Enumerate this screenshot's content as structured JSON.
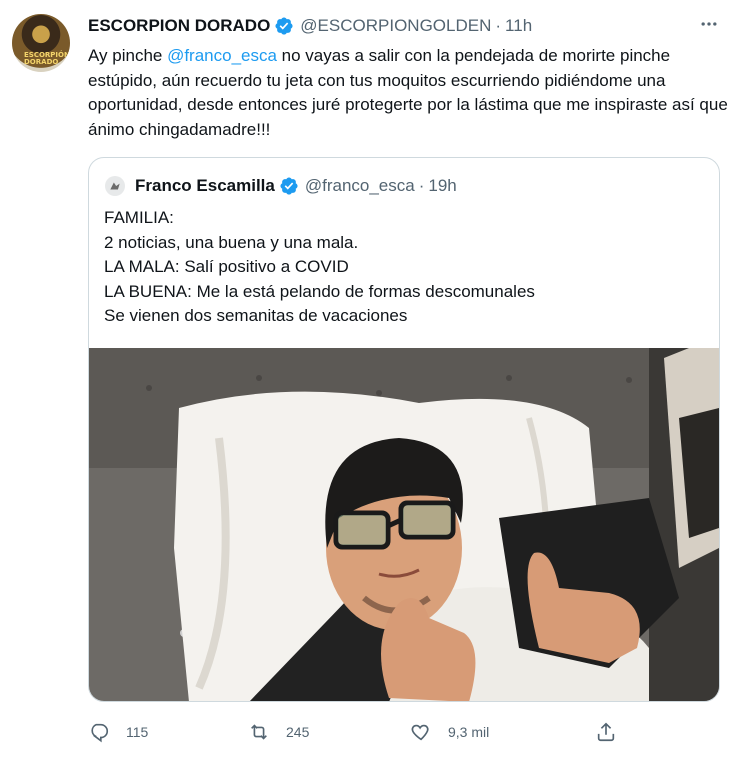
{
  "author": {
    "name": "ESCORPION DORADO",
    "handle": "@ESCORPIONGOLDEN",
    "separator": "·",
    "time": "11h",
    "avatar_text": "ESCORPIÓN DORADO"
  },
  "tweet": {
    "prefix": "Ay pinche ",
    "mention": "@franco_esca",
    "body": " no vayas a salir con la pendejada de morirte pinche estúpido, aún recuerdo tu jeta con tus moquitos escurriendo pidiéndome una oportunidad, desde entonces juré protegerte por la lástima que me inspiraste así que ánimo chingadamadre!!!"
  },
  "quoted": {
    "name": "Franco Escamilla",
    "handle": "@franco_esca",
    "separator": "·",
    "time": "19h",
    "lines": [
      "FAMILIA:",
      "2 noticias, una buena y una mala.",
      "LA MALA: Salí positivo a COVID",
      "LA BUENA: Me la está pelando de formas descomunales",
      "Se vienen dos semanitas de vacaciones"
    ]
  },
  "actions": {
    "replies": "115",
    "retweets": "245",
    "likes": "9,3 mil"
  },
  "icons": {
    "more": "more-icon",
    "verified": "verified-badge-icon",
    "reply": "reply-icon",
    "retweet": "retweet-icon",
    "like": "heart-icon",
    "share": "share-icon"
  },
  "colors": {
    "link": "#1d9bf0",
    "muted": "#536471",
    "text": "#0f1419",
    "border": "#cfd9de"
  }
}
